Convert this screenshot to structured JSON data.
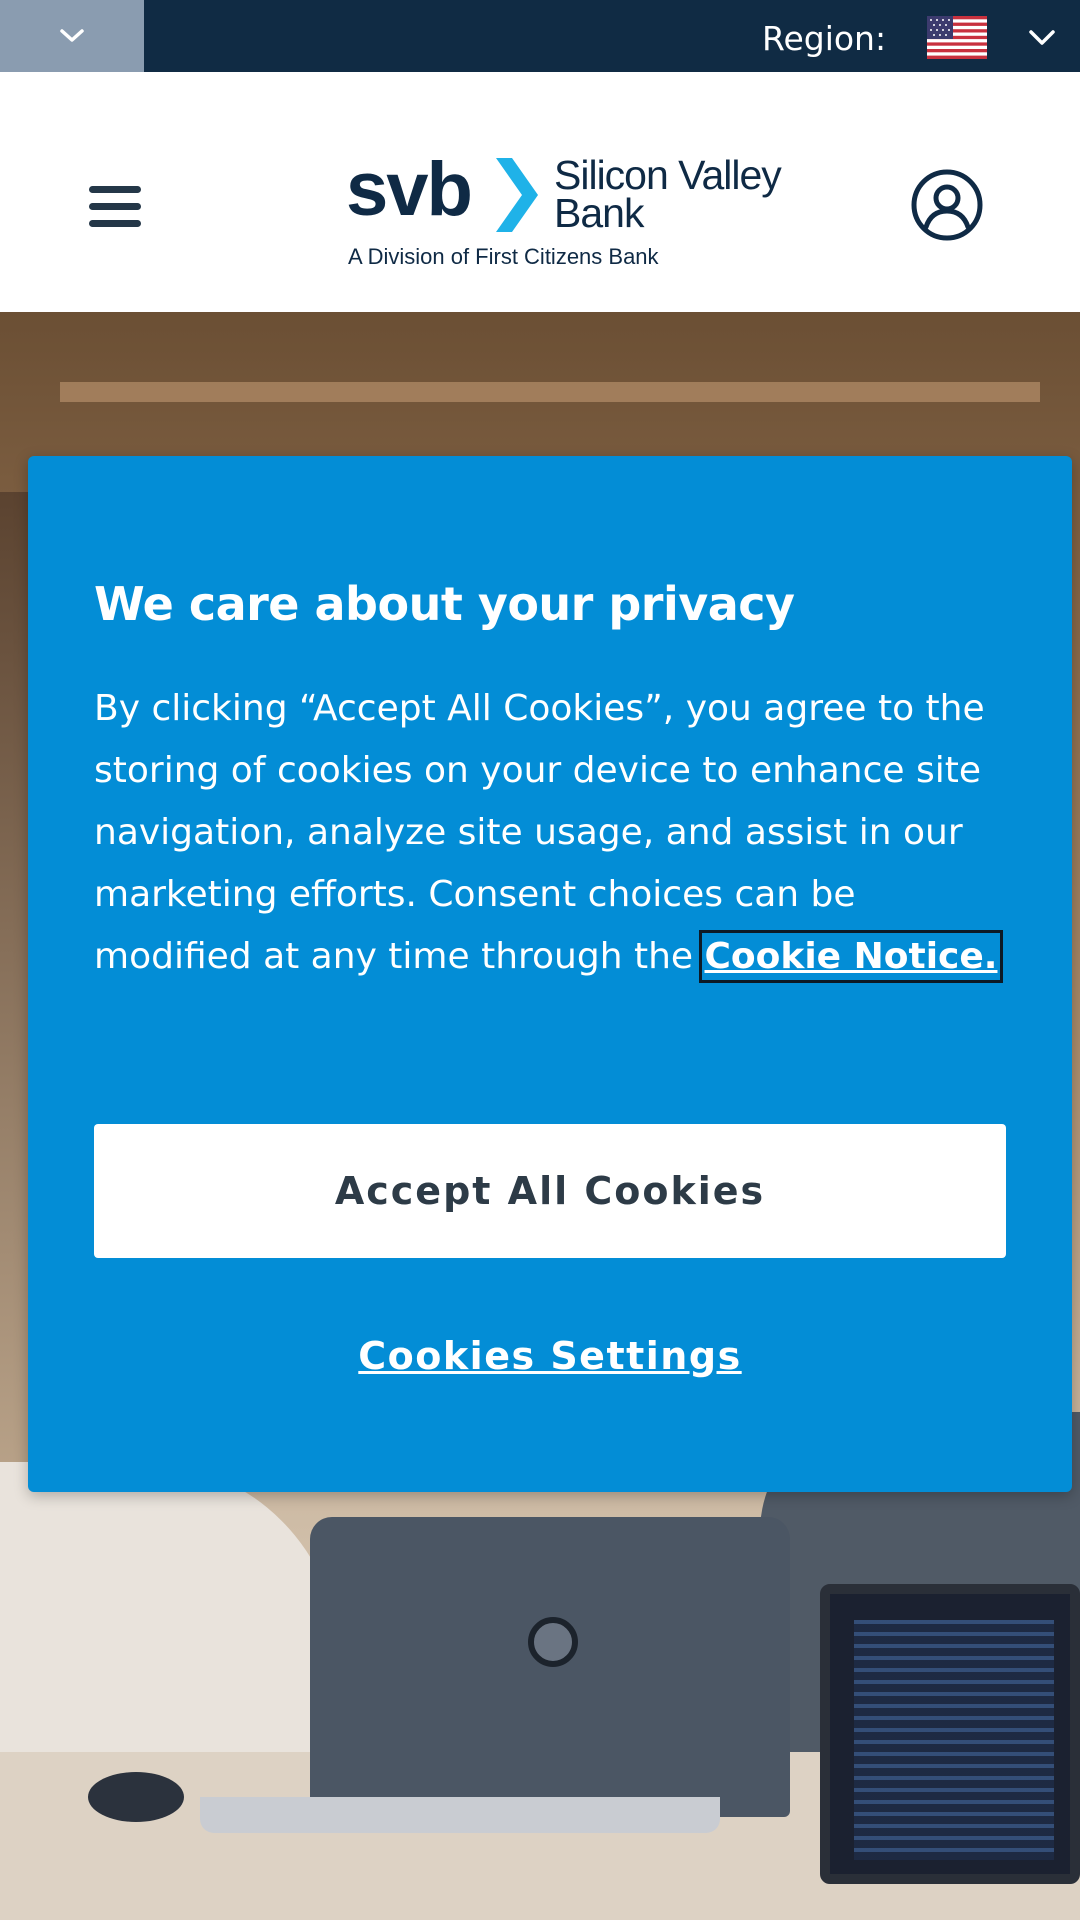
{
  "topbar": {
    "region_label": "Region:",
    "flag": "us-flag-icon"
  },
  "header": {
    "logo": {
      "wordmark": "svb",
      "name": "Silicon Valley Bank",
      "tagline": "A Division of First Citizens Bank"
    },
    "menu_icon": "hamburger-menu-icon",
    "account_icon": "user-account-icon"
  },
  "cookie_banner": {
    "title": "We care about your privacy",
    "body": "By clicking “Accept All Cookies”, you agree to the storing of cookies on your device to enhance site navigation, analyze site usage, and assist in our marketing efforts. Consent choices can be modified at any time through the",
    "link_text": "Cookie Notice.",
    "accept_label": "Accept All Cookies",
    "settings_label": "Cookies Settings"
  },
  "colors": {
    "topbar": "#102b44",
    "brand_navy": "#0f2a45",
    "brand_cyan": "#1fb2e8",
    "banner_blue": "#038dd6"
  }
}
